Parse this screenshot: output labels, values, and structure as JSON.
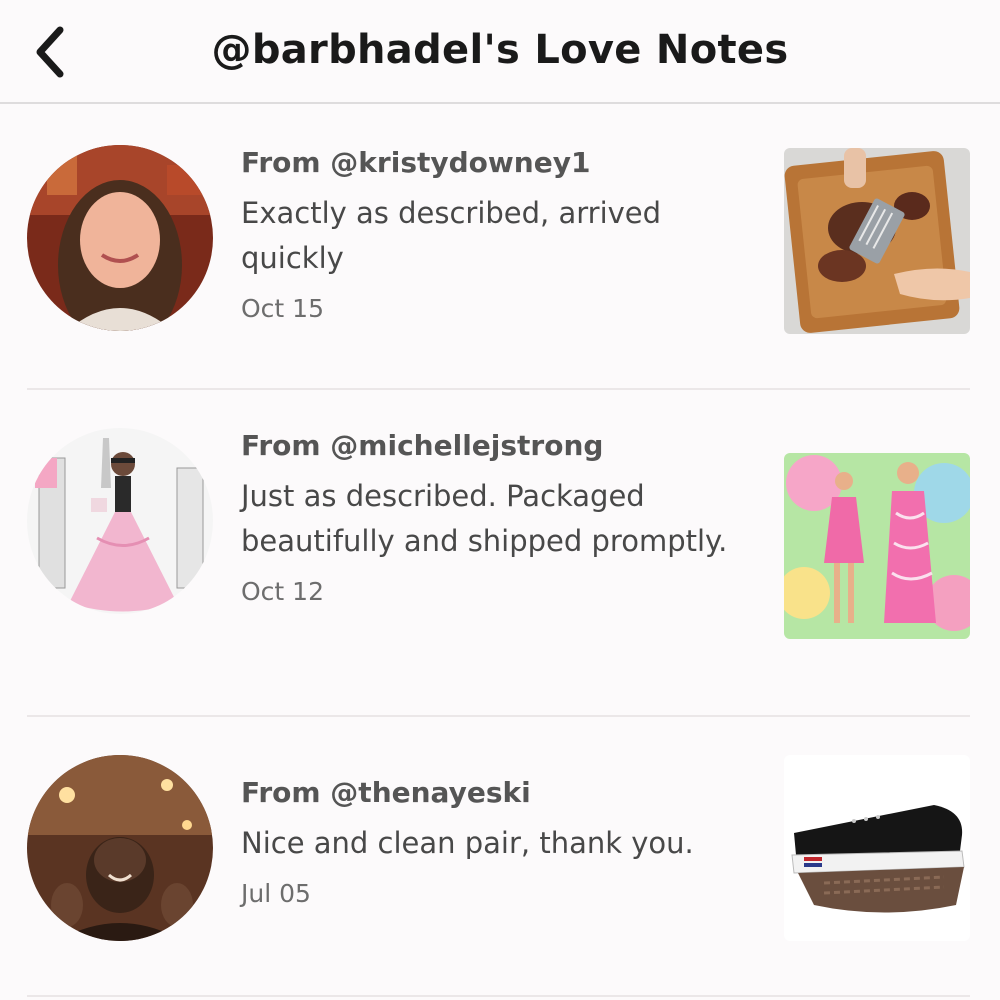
{
  "header": {
    "title": "@barbhadel's Love Notes",
    "back_icon": "chevron-left-icon"
  },
  "notes": [
    {
      "from": "From @kristydowney1",
      "message": "Exactly as described, arrived quickly",
      "date": "Oct 15",
      "avatar": "profile photo",
      "thumbnail": "meat shredder claws on cutting board"
    },
    {
      "from": "From @michellejstrong",
      "message": "Just as described. Packaged beautifully and shipped promptly.",
      "date": "Oct 12",
      "avatar": "illustration of woman in pink gown",
      "thumbnail": "pink patterned dresses"
    },
    {
      "from": "From @thenayeski",
      "message": "Nice and clean pair, thank you.",
      "date": "Jul 05",
      "avatar": "profile photo",
      "thumbnail": "black canvas sneakers"
    }
  ],
  "colors": {
    "background": "#fcfafb",
    "divider": "#ebe7e8",
    "title": "#1a1a1a",
    "secondary_text": "#555555"
  }
}
